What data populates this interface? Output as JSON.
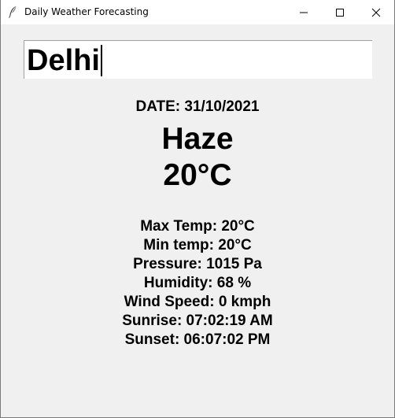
{
  "window": {
    "title": "Daily Weather Forecasting",
    "icon": "feather-icon",
    "controls": {
      "minimize_icon": "minimize-icon",
      "maximize_icon": "maximize-icon",
      "close_icon": "close-icon"
    }
  },
  "search": {
    "city_value": "Delhi"
  },
  "weather": {
    "date_line": "DATE: 31/10/2021",
    "condition": "Haze",
    "temperature": "20°C",
    "details": [
      "Max Temp: 20°C",
      "Min temp: 20°C",
      "Pressure: 1015 Pa",
      "Humidity: 68 %",
      "Wind Speed: 0 kmph",
      "Sunrise: 07:02:19 AM",
      "Sunset: 06:07:02 PM"
    ]
  },
  "colors": {
    "background": "#f0f0f0",
    "titlebar": "#ffffff",
    "text": "#000000"
  }
}
